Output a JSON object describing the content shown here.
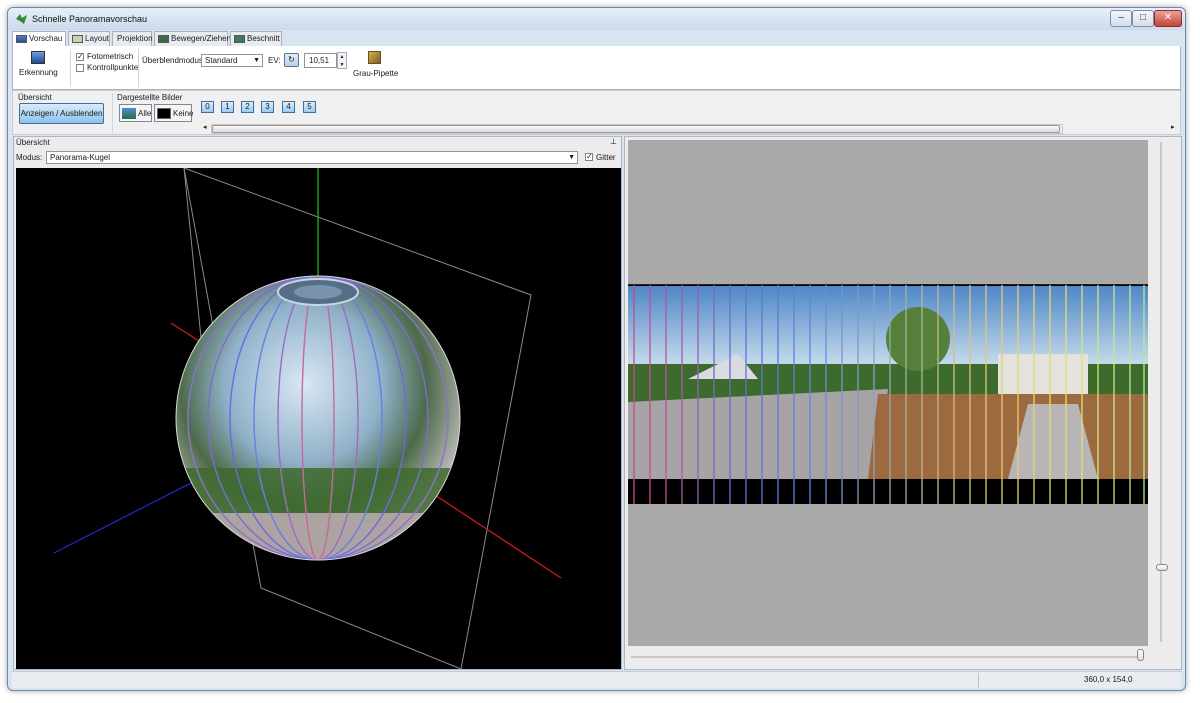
{
  "window": {
    "title": "Schnelle Panoramavorschau"
  },
  "tabs": [
    {
      "label": "Vorschau"
    },
    {
      "label": "Layout"
    },
    {
      "label": "Projektion"
    },
    {
      "label": "Bewegen/Ziehen"
    },
    {
      "label": "Beschnitt"
    }
  ],
  "toolbar": {
    "erkennung_label": "Erkennung",
    "fotometrisch_label": "Fotometrisch",
    "kontrollpunkte_label": "Kontrollpunkte",
    "blend_label": "Überblendmodus:",
    "blend_value": "Standard",
    "ev_label": "EV:",
    "ev_value": "10,51",
    "grau_pipette_label": "Grau-Pipette"
  },
  "overview_bar": {
    "section_label": "Übersicht",
    "toggle_button": "Anzeigen / Ausblenden",
    "shown_images_label": "Dargestellte Bilder",
    "all_button": "Alle",
    "none_button": "Keine",
    "images": [
      "0",
      "1",
      "2",
      "3",
      "4",
      "5"
    ]
  },
  "left_panel": {
    "title": "Übersicht",
    "mode_label": "Modus:",
    "mode_value": "Panorama-Kugel",
    "grid_label": "Gitter"
  },
  "status": {
    "size": "360,0 x 154,0"
  },
  "colors": {
    "accent": "#3f6fa0",
    "canvas": "#000000",
    "preview_bg": "#a9a9a9"
  }
}
